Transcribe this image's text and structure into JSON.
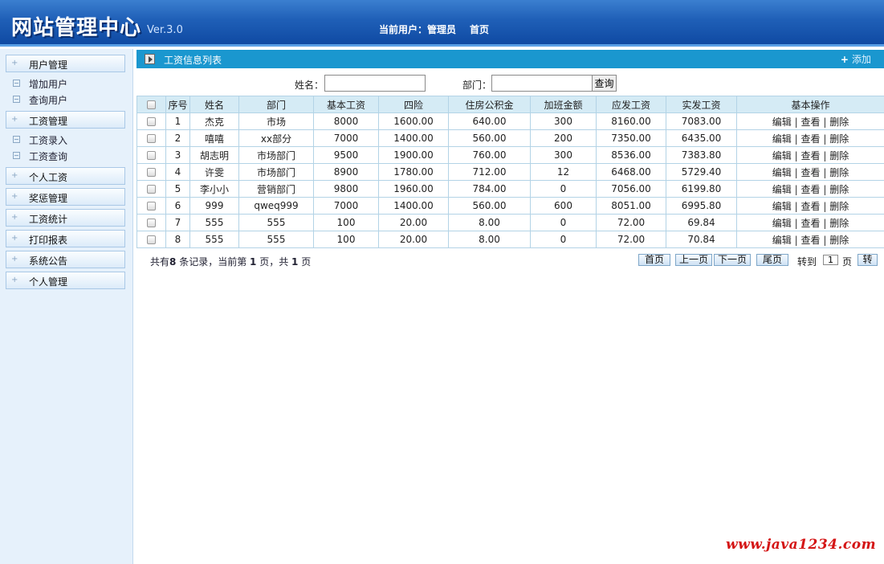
{
  "header": {
    "logo": "网站管理中心",
    "version": "Ver.3.0",
    "current_user": "当前用户：管理员",
    "home_link": "首页"
  },
  "sidebar": {
    "user_mgmt": "用户管理",
    "add_user": "增加用户",
    "query_user": "查询用户",
    "salary_mgmt": "工资管理",
    "salary_entry": "工资录入",
    "salary_query": "工资查询",
    "personal_salary": "个人工资",
    "reward_mgmt": "奖惩管理",
    "salary_stats": "工资统计",
    "print_report": "打印报表",
    "notice": "系统公告",
    "personal_mgmt": "个人管理"
  },
  "panel": {
    "title": "工资信息列表",
    "add_label": "添加"
  },
  "search": {
    "name_label": "姓名：",
    "name_value": "",
    "dept_label": "部门：",
    "dept_value": "",
    "button": "查询"
  },
  "table": {
    "headers": [
      "序号",
      "姓名",
      "部门",
      "基本工资",
      "四险",
      "住房公积金",
      "加班金额",
      "应发工资",
      "实发工资",
      "基本操作"
    ],
    "rows": [
      [
        "1",
        "杰克",
        "市场",
        "8000",
        "1600.00",
        "640.00",
        "300",
        "8160.00",
        "7083.00"
      ],
      [
        "2",
        "嘻嘻",
        "xx部分",
        "7000",
        "1400.00",
        "560.00",
        "200",
        "7350.00",
        "6435.00"
      ],
      [
        "3",
        "胡志明",
        "市场部门",
        "9500",
        "1900.00",
        "760.00",
        "300",
        "8536.00",
        "7383.80"
      ],
      [
        "4",
        "许雯",
        "市场部门",
        "8900",
        "1780.00",
        "712.00",
        "12",
        "6468.00",
        "5729.40"
      ],
      [
        "5",
        "李小小",
        "营销部门",
        "9800",
        "1960.00",
        "784.00",
        "0",
        "7056.00",
        "6199.80"
      ],
      [
        "6",
        "999",
        "qweq999",
        "7000",
        "1400.00",
        "560.00",
        "600",
        "8051.00",
        "6995.80"
      ],
      [
        "7",
        "555",
        "555",
        "100",
        "20.00",
        "8.00",
        "0",
        "72.00",
        "69.84"
      ],
      [
        "8",
        "555",
        "555",
        "100",
        "20.00",
        "8.00",
        "0",
        "72.00",
        "70.84"
      ]
    ],
    "ops": {
      "edit": "编辑",
      "view": "查看",
      "delete": "删除",
      "sep": "|"
    }
  },
  "pager": {
    "prefix": "共有",
    "total": "8",
    "mid1": " 条记录，当前第 ",
    "current": "1",
    "mid2": " 页，共 ",
    "pages": "1",
    "suffix": " 页",
    "first": "首页",
    "prev": "上一页",
    "next": "下一页",
    "last": "尾页",
    "goto_label": "转到",
    "goto_value": "1",
    "page_unit": "页",
    "go": "转"
  },
  "watermark": "www.java1234.com"
}
